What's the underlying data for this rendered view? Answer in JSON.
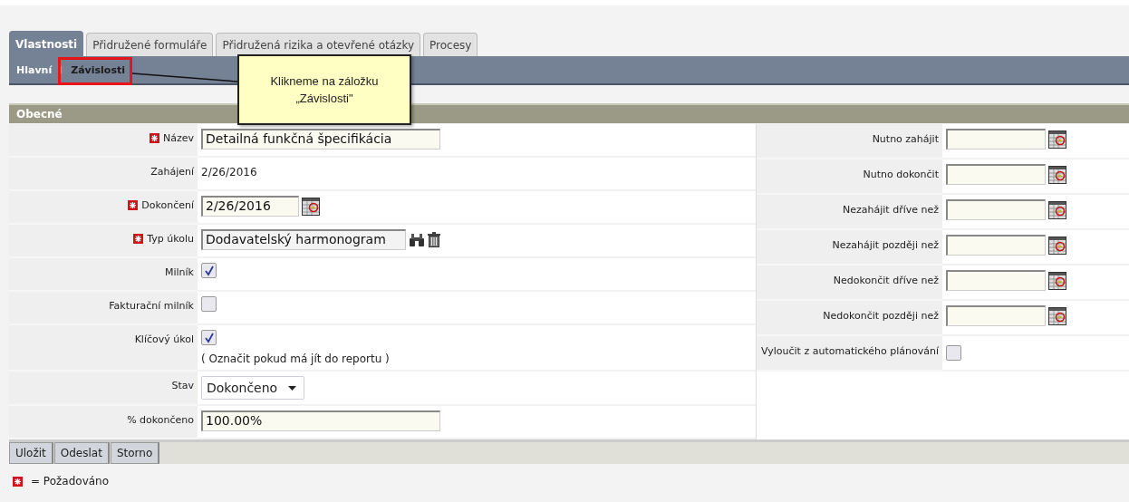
{
  "tabs": [
    {
      "label": "Vlastnosti",
      "selected": true
    },
    {
      "label": "Přidružené formuláře",
      "selected": false
    },
    {
      "label": "Přidružená rizika a otevřené otázky",
      "selected": false
    },
    {
      "label": "Procesy",
      "selected": false
    }
  ],
  "subtabs": [
    {
      "label": "Hlavní",
      "selected": true
    },
    {
      "label": "Závislosti",
      "selected": false,
      "highlighted": true
    }
  ],
  "callout": {
    "lines": [
      "Klikneme na záložku",
      "„Závislosti\""
    ]
  },
  "section": {
    "title": "Obecné"
  },
  "left_fields": [
    {
      "kind": "input",
      "label": "Název",
      "required": true,
      "value": "Detailná funkčná špecifikácia"
    },
    {
      "kind": "text",
      "label": "Zahájení",
      "required": false,
      "value": "2/26/2016"
    },
    {
      "kind": "date",
      "label": "Dokončení",
      "required": true,
      "value": "2/26/2016"
    },
    {
      "kind": "lookup",
      "label": "Typ úkolu",
      "required": true,
      "value": "Dodavatelský harmonogram"
    },
    {
      "kind": "checkbox",
      "label": "Milník",
      "required": false,
      "checked": true
    },
    {
      "kind": "checkbox",
      "label": "Fakturační milník",
      "required": false,
      "checked": false
    },
    {
      "kind": "checkbox",
      "label": "Klíčový úkol",
      "required": false,
      "checked": true,
      "note": "( Označit pokud má jít do reportu )"
    },
    {
      "kind": "select",
      "label": "Stav",
      "required": false,
      "value": "Dokončeno"
    },
    {
      "kind": "input",
      "label": "% dokončeno",
      "required": false,
      "value": "100.00%"
    }
  ],
  "right_fields": [
    {
      "kind": "date",
      "label": "Nutno zahájit"
    },
    {
      "kind": "date",
      "label": "Nutno dokončit"
    },
    {
      "kind": "date",
      "label": "Nezahájit dříve než"
    },
    {
      "kind": "date",
      "label": "Nezahájit později než"
    },
    {
      "kind": "date",
      "label": "Nedokončit dříve než"
    },
    {
      "kind": "date",
      "label": "Nedokončit později než"
    },
    {
      "kind": "checkbox",
      "label": "Vyloučit z automatického plánování",
      "checked": false
    }
  ],
  "buttons": [
    "Uložit",
    "Odeslat",
    "Storno"
  ],
  "legend": {
    "text": "= Požadováno"
  }
}
